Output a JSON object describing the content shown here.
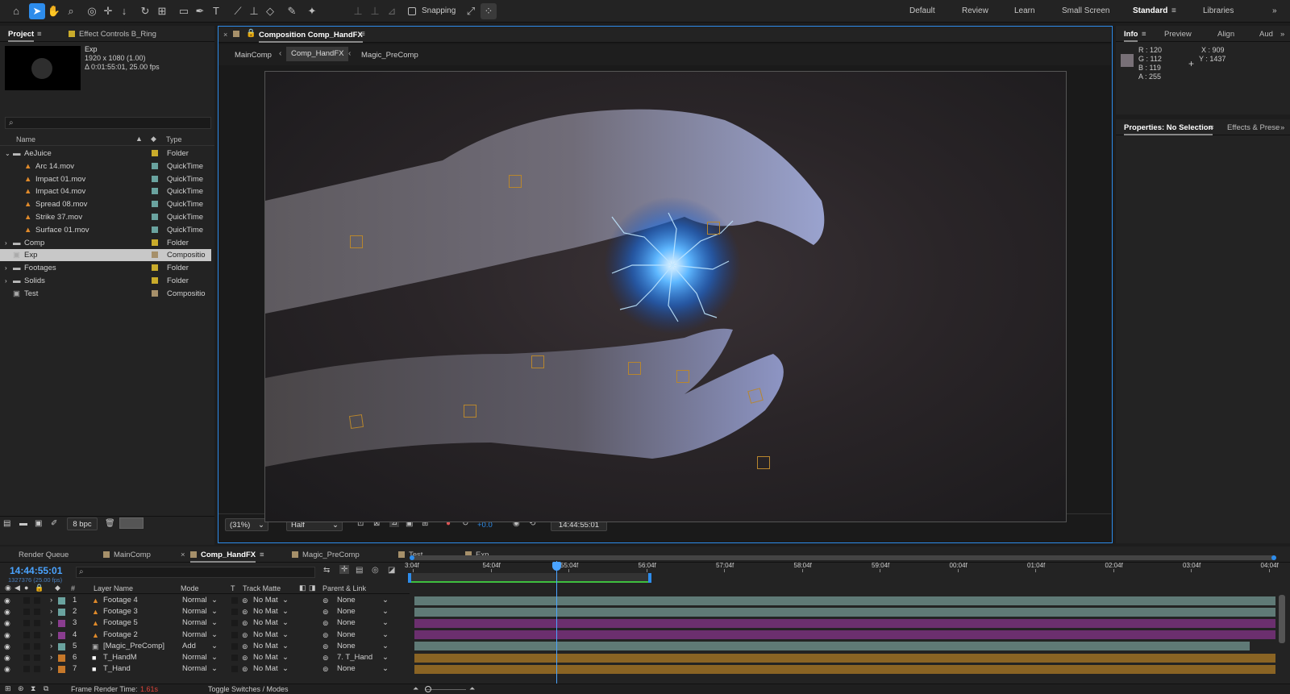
{
  "toolbar": {
    "snapping_label": "Snapping",
    "workspaces": [
      "Default",
      "Review",
      "Learn",
      "Small Screen",
      "Standard",
      "Libraries"
    ],
    "active_workspace": "Standard",
    "tools": [
      "home-icon",
      "selection-icon",
      "hand-icon",
      "zoom-icon",
      "orbit-icon",
      "pan-icon",
      "dolly-icon",
      "rotate-icon",
      "anchor-icon",
      "rectangle-icon",
      "pen-icon",
      "type-icon",
      "brush-icon",
      "clone-stamp-icon",
      "eraser-icon",
      "roto-brush-icon",
      "puppet-icon"
    ]
  },
  "project": {
    "tab_label": "Project",
    "effect_controls_label": "Effect Controls B_Ring",
    "preview_name": "Exp",
    "preview_size": "1920 x 1080 (1.00)",
    "preview_duration": "Δ 0:01:55:01, 25.00 fps",
    "col_name": "Name",
    "col_type": "Type",
    "bpc": "8 bpc",
    "items": [
      {
        "name": "AeJuice",
        "type": "Folder",
        "kind": "folder",
        "indent": 0,
        "expanded": true,
        "color": "#c9ab2b"
      },
      {
        "name": "Arc 14.mov",
        "type": "QuickTime",
        "kind": "footage",
        "indent": 1,
        "color": "#6aa39f"
      },
      {
        "name": "Impact 01.mov",
        "type": "QuickTime",
        "kind": "footage",
        "indent": 1,
        "color": "#6aa39f"
      },
      {
        "name": "Impact 04.mov",
        "type": "QuickTime",
        "kind": "footage",
        "indent": 1,
        "color": "#6aa39f"
      },
      {
        "name": "Spread 08.mov",
        "type": "QuickTime",
        "kind": "footage",
        "indent": 1,
        "color": "#6aa39f"
      },
      {
        "name": "Strike 37.mov",
        "type": "QuickTime",
        "kind": "footage",
        "indent": 1,
        "color": "#6aa39f"
      },
      {
        "name": "Surface 01.mov",
        "type": "QuickTime",
        "kind": "footage",
        "indent": 1,
        "color": "#6aa39f"
      },
      {
        "name": "Comp",
        "type": "Folder",
        "kind": "folder",
        "indent": 0,
        "color": "#c9ab2b"
      },
      {
        "name": "Exp",
        "type": "Compositio",
        "kind": "comp",
        "indent": 0,
        "selected": true,
        "color": "#a6906a"
      },
      {
        "name": "Footages",
        "type": "Folder",
        "kind": "folder",
        "indent": 0,
        "color": "#c9ab2b"
      },
      {
        "name": "Solids",
        "type": "Folder",
        "kind": "folder",
        "indent": 0,
        "color": "#c9ab2b"
      },
      {
        "name": "Test",
        "type": "Compositio",
        "kind": "comp",
        "indent": 0,
        "color": "#a6906a"
      }
    ]
  },
  "composition": {
    "title": "Composition Comp_HandFX",
    "crumbs": [
      "MainComp",
      "Comp_HandFX",
      "Magic_PreComp"
    ],
    "zoom": "(31%)",
    "resolution": "Half",
    "exposure": "+0.0",
    "timecode": "14:44:55:01"
  },
  "info": {
    "tabs": [
      "Info",
      "Preview",
      "Align",
      "Aud"
    ],
    "r": "R : 120",
    "g": "G : 112",
    "b": "B : 119",
    "a": "A : 255",
    "x": "X : 909",
    "y": "Y : 1437",
    "swatch": "#787077"
  },
  "properties": {
    "tab_label": "Properties: No Selection",
    "effects_label": "Effects & Prese"
  },
  "timeline": {
    "tabs": [
      "Render Queue",
      "MainComp",
      "Comp_HandFX",
      "Magic_PreComp",
      "Test",
      "Exp"
    ],
    "active_tab": "Comp_HandFX",
    "timecode": "14:44:55:01",
    "frames": "1327376 (25.00 fps)",
    "cols": {
      "layer_name": "Layer Name",
      "mode": "Mode",
      "t": "T",
      "track_matte": "Track Matte",
      "parent": "Parent & Link"
    },
    "ruler": [
      "3:04f",
      "54:04f",
      "55:04f",
      "56:04f",
      "57:04f",
      "58:04f",
      "59:04f",
      "00:04f",
      "01:04f",
      "02:04f",
      "03:04f",
      "04:04f"
    ],
    "layers": [
      {
        "num": "1",
        "name": "Footage 4",
        "mode": "Normal",
        "matte": "No Mat",
        "parent": "None",
        "label": "#6aa39f",
        "icon": "footage",
        "bar": "#5f7a76"
      },
      {
        "num": "2",
        "name": "Footage 3",
        "mode": "Normal",
        "matte": "No Mat",
        "parent": "None",
        "label": "#6aa39f",
        "icon": "footage",
        "bar": "#5f7a76"
      },
      {
        "num": "3",
        "name": "Footage 5",
        "mode": "Normal",
        "matte": "No Mat",
        "parent": "None",
        "label": "#8a3d8f",
        "icon": "footage",
        "bar": "#6b2f6e"
      },
      {
        "num": "4",
        "name": "Footage 2",
        "mode": "Normal",
        "matte": "No Mat",
        "parent": "None",
        "label": "#8a3d8f",
        "icon": "footage",
        "bar": "#6b2f6e"
      },
      {
        "num": "5",
        "name": "[Magic_PreComp]",
        "mode": "Add",
        "matte": "No Mat",
        "parent": "None",
        "label": "#6aa39f",
        "icon": "comp",
        "bar": "#5f7a76"
      },
      {
        "num": "6",
        "name": "T_HandM",
        "mode": "Normal",
        "matte": "No Mat",
        "parent": "7. T_Hand",
        "label": "#c6782a",
        "icon": "solid",
        "bar": "#8a6424"
      },
      {
        "num": "7",
        "name": "T_Hand",
        "mode": "Normal",
        "matte": "No Mat",
        "parent": "None",
        "label": "#c6782a",
        "icon": "solid",
        "bar": "#8a6424"
      }
    ],
    "frame_render_label": "Frame Render Time:",
    "frame_render_value": "1.61s",
    "toggle_label": "Toggle Switches / Modes"
  }
}
